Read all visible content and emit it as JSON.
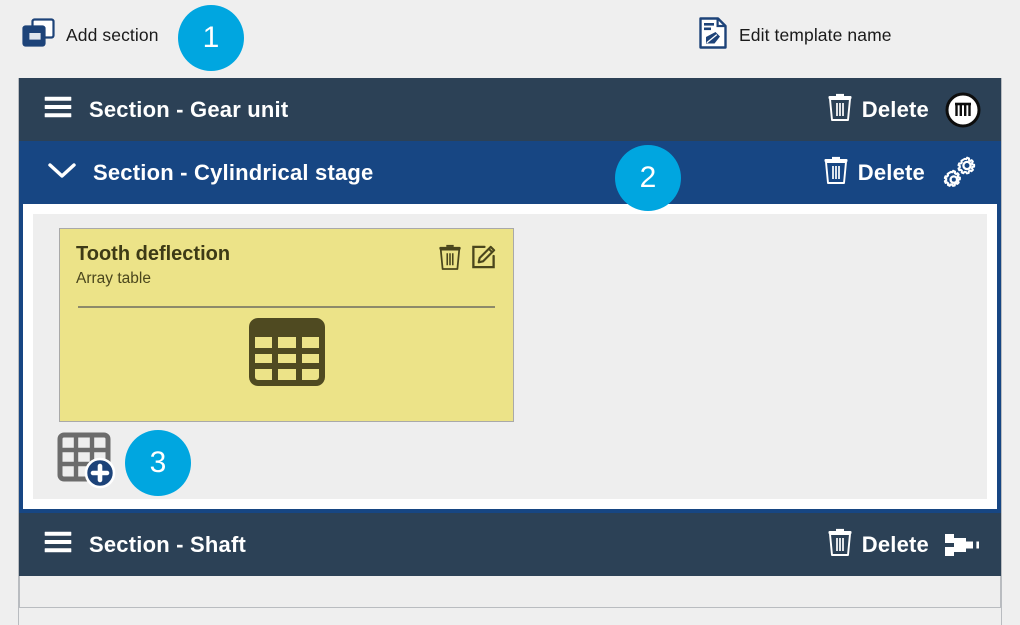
{
  "toolbar": {
    "add_section": {
      "label": "Add section",
      "icon": "add-section-icon"
    },
    "edit_template": {
      "label": "Edit template name",
      "icon": "edit-document-icon"
    }
  },
  "callouts": [
    {
      "number": "1",
      "target": "add-section-button"
    },
    {
      "number": "2",
      "target": "section-cylindrical-stage-header"
    },
    {
      "number": "3",
      "target": "add-array-table-button"
    }
  ],
  "colors": {
    "badge": "#00a6e0",
    "section_collapsed": "#2c4156",
    "section_expanded": "#174683",
    "card_background": "#ece388",
    "panel_background": "#eeeeee",
    "page_background": "#efefef"
  },
  "sections": [
    {
      "title": "Section - Gear unit",
      "state": "collapsed",
      "handle_icon": "hamburger-icon",
      "delete_label": "Delete",
      "delete_icon": "trash-icon",
      "type_icon": "gear-unit-icon"
    },
    {
      "title": "Section - Cylindrical stage",
      "state": "expanded",
      "handle_icon": "chevron-down-icon",
      "delete_label": "Delete",
      "delete_icon": "trash-icon",
      "type_icon": "gears-icon",
      "items": [
        {
          "title": "Tooth deflection",
          "subtitle": "Array table",
          "figure_icon": "table-icon",
          "delete_icon": "trash-icon",
          "edit_icon": "pencil-square-icon"
        }
      ],
      "add_button": {
        "icon": "add-table-icon"
      }
    },
    {
      "title": "Section - Shaft",
      "state": "collapsed",
      "handle_icon": "hamburger-icon",
      "delete_label": "Delete",
      "delete_icon": "trash-icon",
      "type_icon": "shaft-icon"
    }
  ]
}
